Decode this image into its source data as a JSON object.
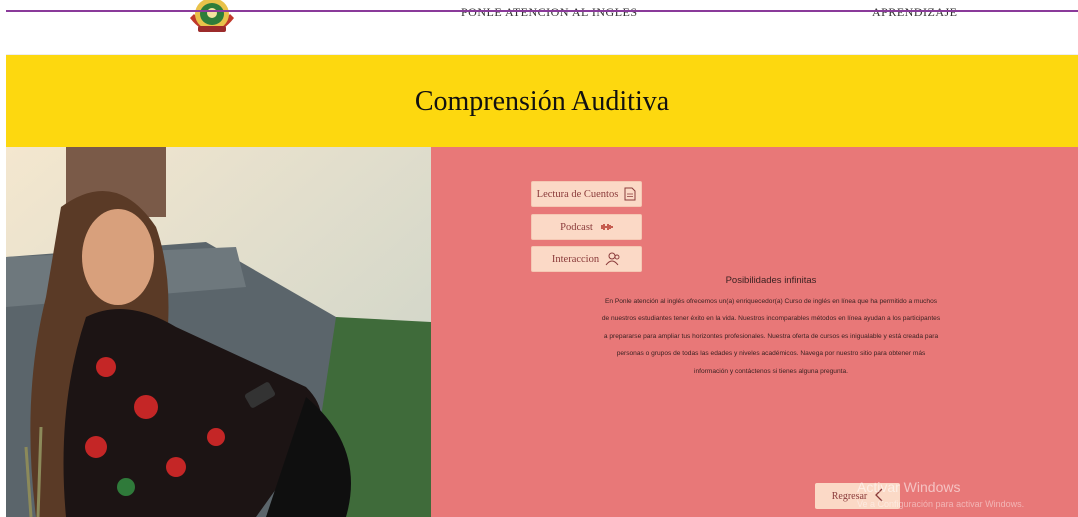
{
  "header": {
    "nav": [
      "PONLE ATENCION AL INGLES",
      "APRENDIZAJE"
    ]
  },
  "banner": {
    "title": "Comprensión Auditiva"
  },
  "actions": {
    "cuentos_label": "Lectura de Cuentos",
    "podcast_label": "Podcast",
    "interaccion_label": "Interaccion"
  },
  "content": {
    "heading": "Posibilidades infinitas",
    "paragraph": "En Ponle atención al inglés ofrecemos un(a) enriquecedor(a) Curso de inglés en línea que ha permitido a muchos de nuestros estudiantes tener éxito en la vida. Nuestros incomparables métodos en línea ayudan a los participantes a prepararse para ampliar tus horizontes profesionales. Nuestra oferta de cursos es inigualable y está creada para personas o grupos de todas las edades y niveles académicos. Navega por nuestro sitio para obtener más información y contáctenos si tienes alguna pregunta."
  },
  "footer": {
    "back_label": "Regresar"
  },
  "overlay": {
    "watermark": "Activar Windows",
    "watermark_sub": "Ve a Configuración para activar Windows."
  },
  "colors": {
    "banner": "#fdd80f",
    "panel": "#e87878",
    "button": "#fbd9c6",
    "top_line": "#8a3a9a"
  }
}
